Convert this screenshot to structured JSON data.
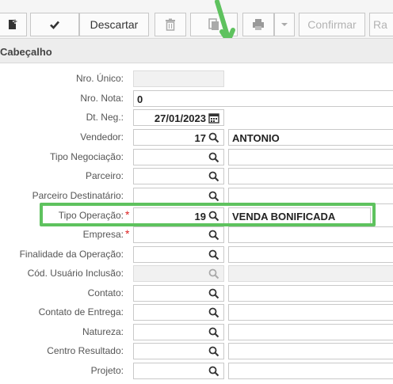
{
  "toolbar": {
    "descartar_label": "Descartar",
    "confirmar_label": "Confirmar",
    "partial_label": "Ra"
  },
  "section": {
    "title": "Cabeçalho"
  },
  "fields": {
    "nro_unico": {
      "label": "Nro. Único:",
      "value": ""
    },
    "nro_nota": {
      "label": "Nro. Nota:",
      "value": "0"
    },
    "dt_neg": {
      "label": "Dt. Neg.:",
      "value": "27/01/2023"
    },
    "vendedor": {
      "label": "Vendedor:",
      "code": "17",
      "name": "ANTONIO"
    },
    "tipo_negociacao": {
      "label": "Tipo Negociação:",
      "code": "",
      "name": ""
    },
    "parceiro": {
      "label": "Parceiro:",
      "code": "",
      "name": ""
    },
    "parceiro_destinatario": {
      "label": "Parceiro Destinatário:",
      "code": "",
      "name": ""
    },
    "tipo_operacao": {
      "label": "Tipo Operação:",
      "code": "19",
      "name": "VENDA BONIFICADA",
      "required": "*"
    },
    "empresa": {
      "label": "Empresa:",
      "code": "",
      "name": "",
      "required": "*"
    },
    "finalidade": {
      "label": "Finalidade da Operação:",
      "code": "",
      "name": ""
    },
    "cod_usuario": {
      "label": "Cód. Usuário Inclusão:",
      "code": "",
      "name": ""
    },
    "contato": {
      "label": "Contato:",
      "code": "",
      "name": ""
    },
    "contato_entrega": {
      "label": "Contato de Entrega:",
      "code": "",
      "name": ""
    },
    "natureza": {
      "label": "Natureza:",
      "code": "",
      "name": ""
    },
    "centro_resultado": {
      "label": "Centro Resultado:",
      "code": "",
      "name": ""
    },
    "projeto": {
      "label": "Projeto:",
      "code": "",
      "name": ""
    }
  },
  "colors": {
    "highlight": "#5ec25e",
    "required": "#d22222",
    "annotation_arrow": "#5ec25e"
  }
}
